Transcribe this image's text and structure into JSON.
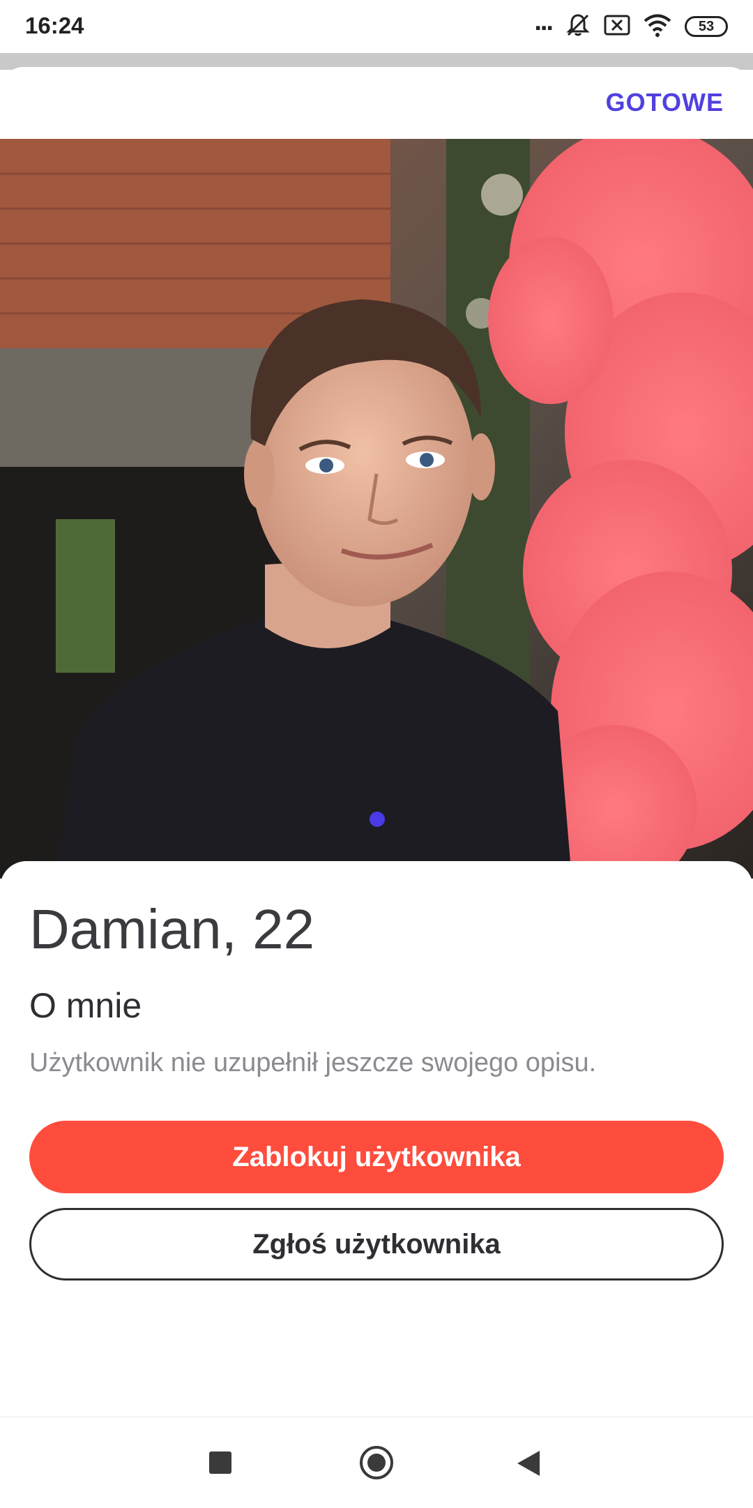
{
  "status_bar": {
    "time": "16:24",
    "more": "...",
    "battery": "53",
    "icons": [
      "more-dots-icon",
      "muted-bell-icon",
      "close-box-icon",
      "wifi-icon",
      "battery-icon"
    ]
  },
  "header": {
    "done_label": "GOTOWE"
  },
  "profile": {
    "photo": "profile-photo",
    "page_indicator": {
      "current": 1,
      "total": 1
    },
    "name_age": "Damian, 22",
    "about_title": "O mnie",
    "about_text": "Użytkownik nie uzupełnił jeszcze swojego opisu."
  },
  "actions": {
    "block_label": "Zablokuj użytkownika",
    "report_label": "Zgłoś użytkownika"
  },
  "colors": {
    "accent": "#5040e0",
    "block_button": "#ff4d3d",
    "text_dark": "#3a3a3f",
    "text_muted": "#8a8a90"
  },
  "nav_bar": {
    "icons": [
      "recents-square-icon",
      "home-circle-icon",
      "back-triangle-icon"
    ]
  }
}
